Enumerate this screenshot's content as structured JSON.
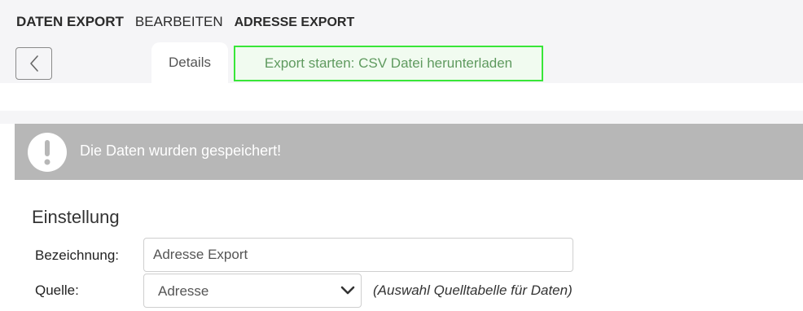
{
  "breadcrumb": {
    "section": "DATEN EXPORT",
    "action": "BEARBEITEN",
    "record": "ADRESSE EXPORT"
  },
  "toolbar": {
    "back_icon": "chevron-left-icon"
  },
  "tabs": {
    "details_label": "Details",
    "export_label": "Export starten: CSV Datei herunterladen"
  },
  "alert": {
    "icon": "exclamation-icon",
    "message": "Die Daten wurden gespeichert!"
  },
  "form": {
    "section_title": "Einstellung",
    "name_label": "Bezeichnung:",
    "name_value": "Adresse Export",
    "source_label": "Quelle:",
    "source_value": "Adresse",
    "source_hint": "(Auswahl Quelltabelle für Daten)"
  },
  "colors": {
    "alert_bg": "#b7b7b7",
    "highlight_border": "#39e639",
    "highlight_text": "#5f9a5f"
  }
}
